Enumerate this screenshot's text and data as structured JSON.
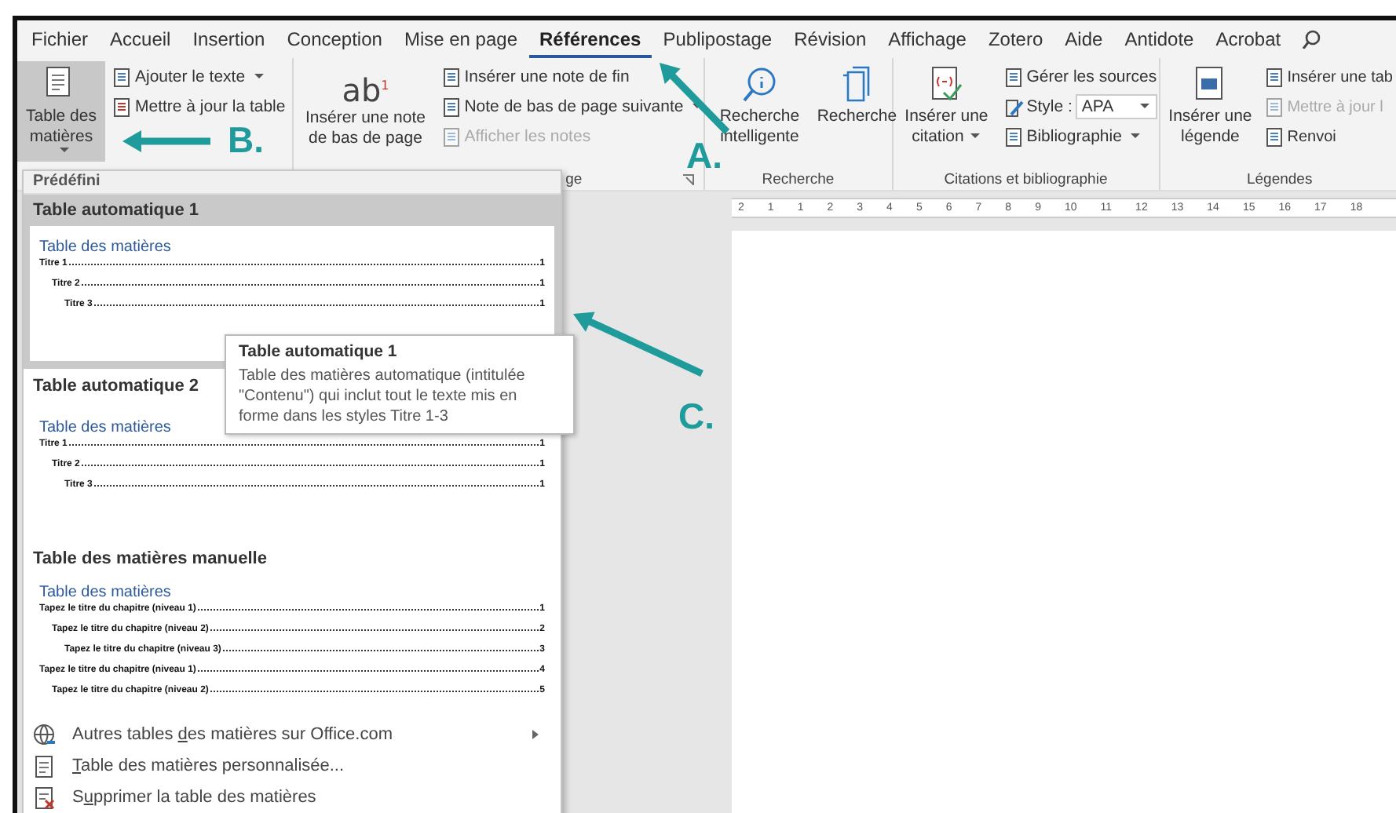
{
  "tabs": [
    {
      "label": "Fichier",
      "selected": false
    },
    {
      "label": "Accueil",
      "selected": false
    },
    {
      "label": "Insertion",
      "selected": false
    },
    {
      "label": "Conception",
      "selected": false
    },
    {
      "label": "Mise en page",
      "selected": false
    },
    {
      "label": "Références",
      "selected": true
    },
    {
      "label": "Publipostage",
      "selected": false
    },
    {
      "label": "Révision",
      "selected": false
    },
    {
      "label": "Affichage",
      "selected": false
    },
    {
      "label": "Zotero",
      "selected": false
    },
    {
      "label": "Aide",
      "selected": false
    },
    {
      "label": "Antidote",
      "selected": false
    },
    {
      "label": "Acrobat",
      "selected": false
    }
  ],
  "ribbon": {
    "groups": [
      {
        "large": [
          {
            "label": "Table des matières",
            "dropdown": true,
            "pressed": true
          }
        ],
        "small": [
          {
            "kind": "button",
            "label": "Ajouter le texte",
            "dropdown": true,
            "disabled": false
          },
          {
            "kind": "button",
            "label": "Mettre à jour la table",
            "dropdown": false,
            "disabled": false
          }
        ]
      },
      {
        "large": [
          {
            "glyph": "ab$^{1}$",
            "label": "Insérer une note de bas de page",
            "dropdown": false,
            "pressed": false
          }
        ],
        "small": [
          {
            "kind": "button",
            "label": "Insérer une note de fin",
            "dropdown": false,
            "disabled": false
          },
          {
            "kind": "button",
            "label": "Note de bas de page suivante",
            "dropdown": true,
            "disabled": false
          },
          {
            "kind": "button",
            "label": "Afficher les notes",
            "dropdown": false,
            "disabled": true
          }
        ],
        "label": "ge",
        "launcher": true
      },
      {
        "large": [
          {
            "label": "Recherche intelligente",
            "dropdown": false,
            "pressed": false
          },
          {
            "label": "Recherche",
            "dropdown": false,
            "pressed": false
          }
        ],
        "label": "Recherche"
      },
      {
        "large": [
          {
            "label": "Insérer une citation",
            "dropdown": true,
            "pressed": false
          }
        ],
        "small": [
          {
            "kind": "button",
            "label": "Gérer les sources",
            "dropdown": false,
            "disabled": false
          },
          {
            "kind": "select",
            "label": "Style :",
            "value": "APA"
          },
          {
            "kind": "button",
            "label": "Bibliographie",
            "dropdown": true,
            "disabled": false
          }
        ],
        "label": "Citations et bibliographie"
      },
      {
        "large": [
          {
            "label": "Insérer une légende",
            "dropdown": false,
            "pressed": false
          }
        ],
        "small": [
          {
            "kind": "button",
            "label": "Insérer une tab",
            "dropdown": false,
            "disabled": false
          },
          {
            "kind": "button",
            "label": "Mettre à jour l",
            "dropdown": false,
            "disabled": true
          },
          {
            "kind": "button",
            "label": "Renvoi",
            "dropdown": false,
            "disabled": false
          }
        ],
        "label": "Légendes"
      }
    ]
  },
  "ruler": {
    "labels": [
      "2",
      "1",
      "1",
      "2",
      "3",
      "4",
      "5",
      "6",
      "7",
      "8",
      "9",
      "10",
      "11",
      "12",
      "13",
      "14",
      "15",
      "16",
      "17",
      "18"
    ]
  },
  "toc_menu": {
    "header": "Prédéfini",
    "sections": [
      {
        "title": "Table automatique 1",
        "selected": true,
        "preview": {
          "heading": "Table des matières",
          "entries": [
            {
              "text": "Titre 1",
              "page": "1",
              "children": [
                {
                  "text": "Titre 2",
                  "page": "1",
                  "children": [
                    {
                      "text": "Titre 3",
                      "page": "1"
                    }
                  ]
                }
              ]
            }
          ]
        }
      },
      {
        "title": "Table automatique 2",
        "selected": false,
        "preview": {
          "heading": "Table des matières",
          "entries": [
            {
              "text": "Titre 1",
              "page": "1",
              "children": [
                {
                  "text": "Titre 2",
                  "page": "1",
                  "children": [
                    {
                      "text": "Titre 3",
                      "page": "1"
                    }
                  ]
                }
              ]
            }
          ]
        }
      },
      {
        "title": "Table des matières manuelle",
        "selected": false,
        "preview": {
          "heading": "Table des matières",
          "entries": [
            {
              "text": "Tapez le titre du chapitre (niveau 1)",
              "page": "1",
              "children": [
                {
                  "text": "Tapez le titre du chapitre (niveau 2)",
                  "page": "2",
                  "children": [
                    {
                      "text": "Tapez le titre du chapitre (niveau 3)",
                      "page": "3"
                    }
                  ]
                }
              ]
            },
            {
              "text": "Tapez le titre du chapitre (niveau 1)",
              "page": "4",
              "children": [
                {
                  "text": "Tapez le titre du chapitre (niveau 2)",
                  "page": "5"
                }
              ]
            }
          ]
        }
      }
    ],
    "commands": [
      {
        "before": "Autres tables ",
        "key": "d",
        "after": "es matières sur Office.com",
        "submenu": true
      },
      {
        "key": "T",
        "after": "able des matières personnalisée...",
        "submenu": false
      },
      {
        "before": "S",
        "key": "u",
        "after": "pprimer la table des matières",
        "submenu": false
      }
    ]
  },
  "tooltip": {
    "title": "Table automatique 1",
    "text": "Table des matières automatique (intitulée \"Contenu\") qui inclut tout le texte mis en forme dans les styles Titre 1-3"
  },
  "annotations": [
    {
      "label": "A."
    },
    {
      "label": "B."
    },
    {
      "label": "C."
    }
  ]
}
